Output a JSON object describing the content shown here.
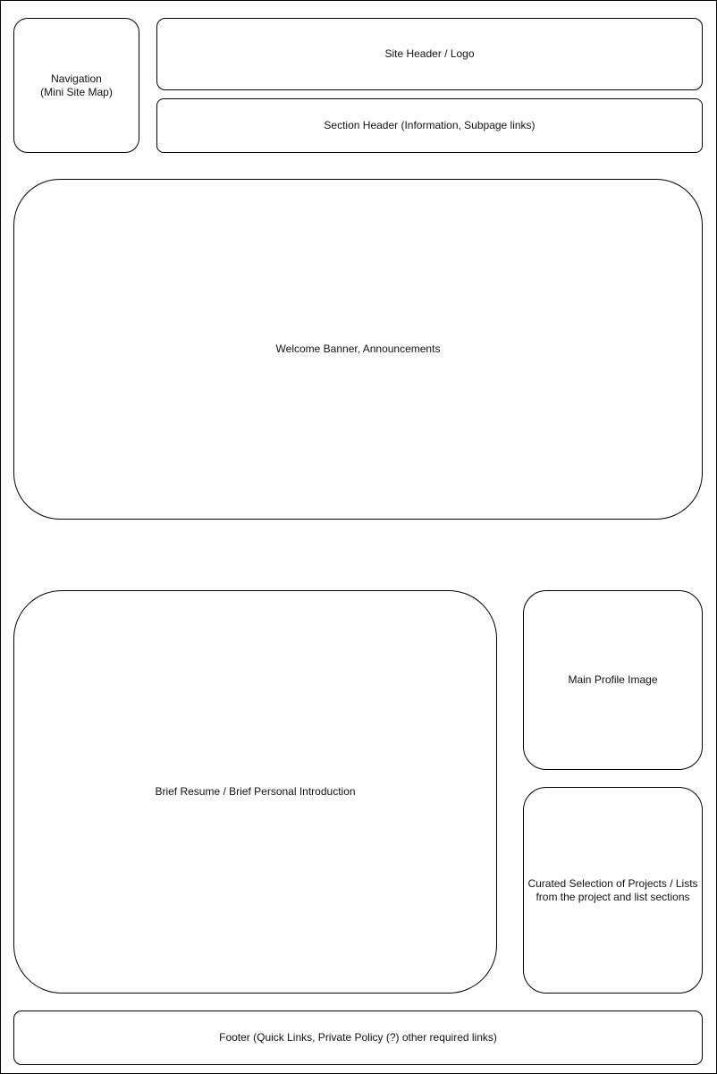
{
  "boxes": {
    "navigation": "Navigation\n(Mini Site Map)",
    "site_header": "Site Header / Logo",
    "section_header": "Section Header (Information, Subpage links)",
    "welcome": "Welcome Banner, Announcements",
    "resume": "Brief Resume / Brief  Personal Introduction",
    "profile": "Main Profile Image",
    "curated": "Curated Selection of Projects / Lists\nfrom the project and list sections",
    "footer": "Footer (Quick Links, Private Policy (?) other required links)"
  }
}
